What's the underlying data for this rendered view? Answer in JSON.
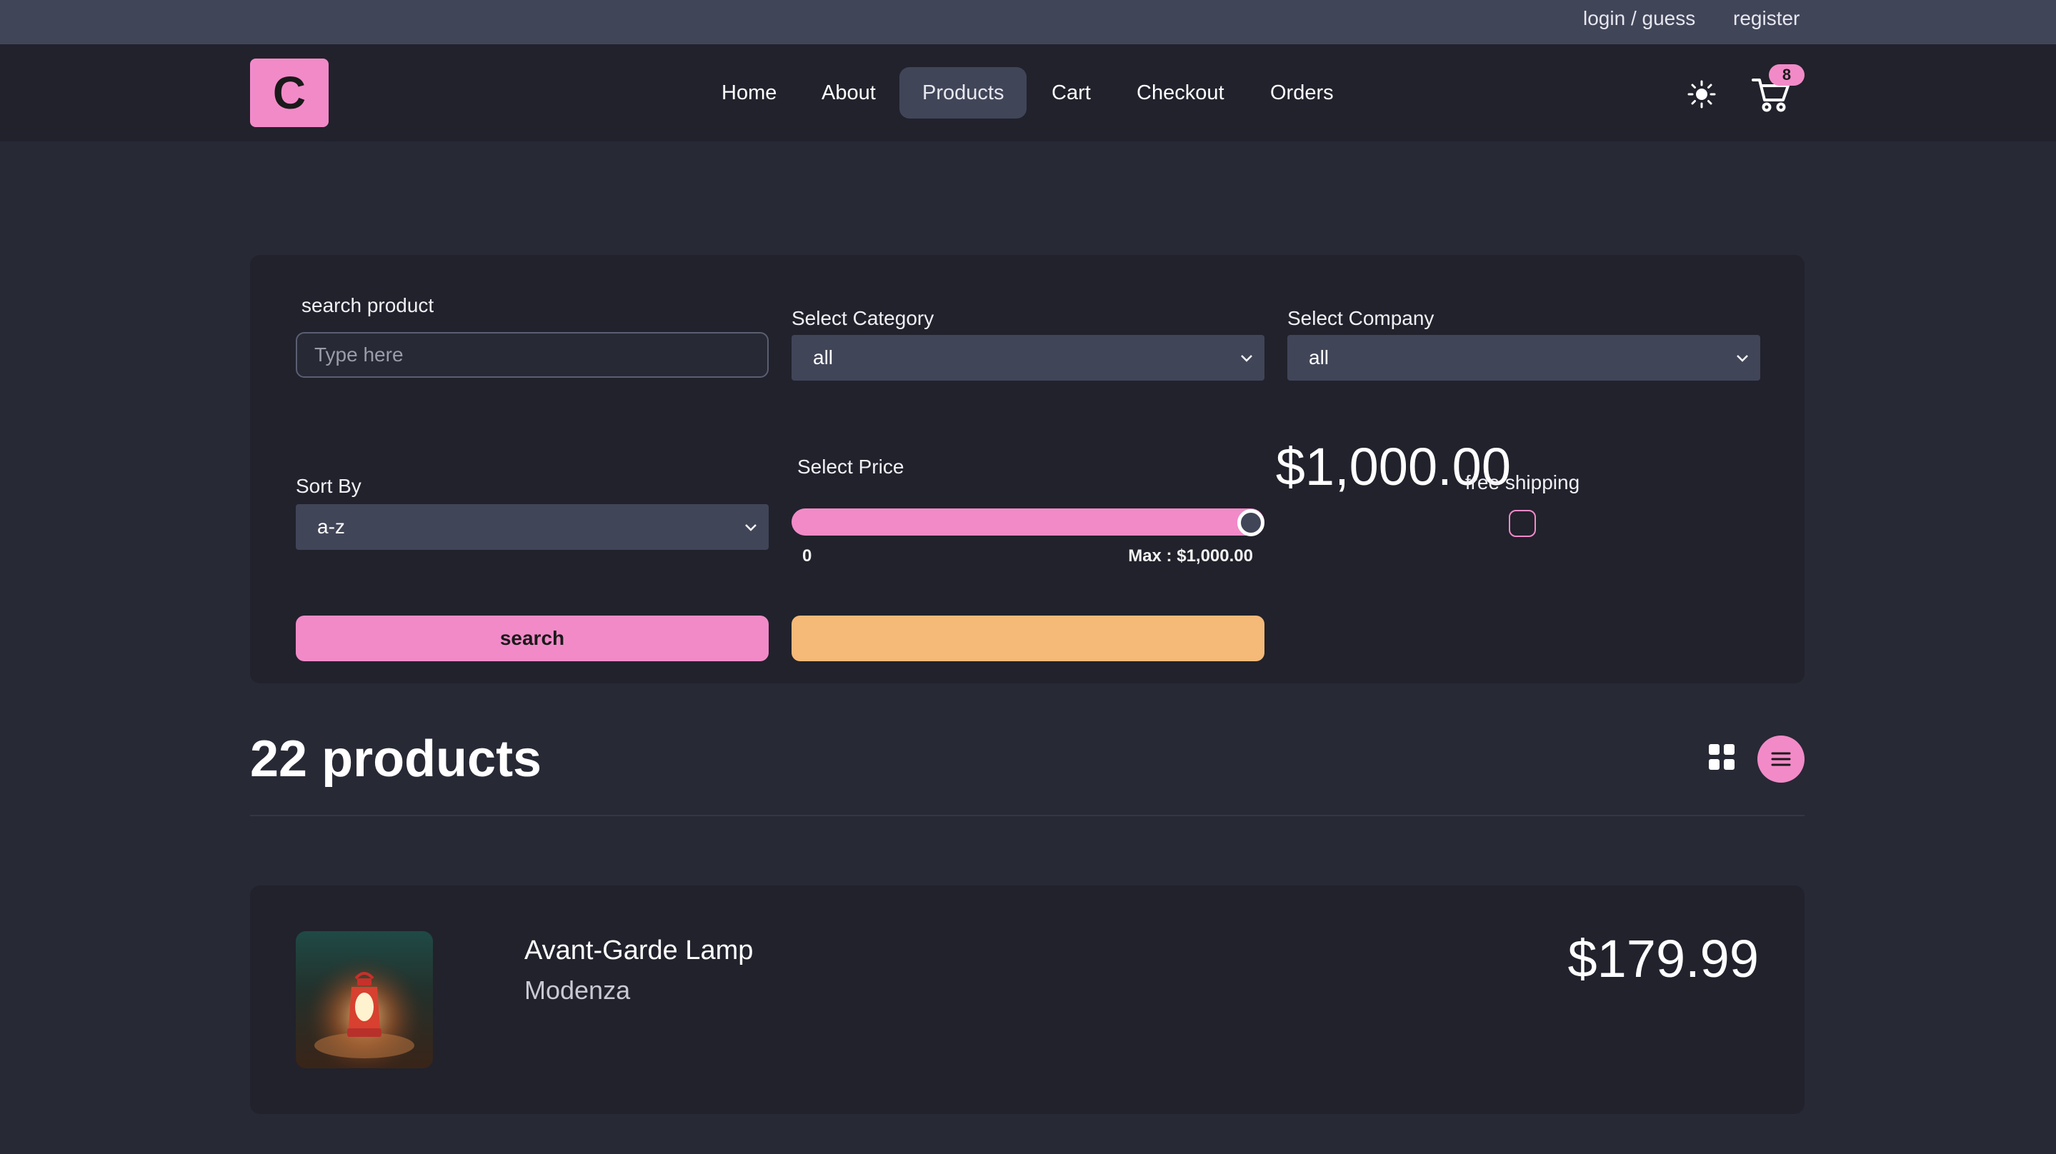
{
  "topbar": {
    "login": "login / guess",
    "register": "register"
  },
  "navbar": {
    "logo": "C",
    "links": [
      "Home",
      "About",
      "Products",
      "Cart",
      "Checkout",
      "Orders"
    ],
    "active": "Products",
    "cart_count": "8"
  },
  "filters": {
    "search_label": "search product",
    "search_placeholder": "Type here",
    "search_value": "",
    "category_label": "Select Category",
    "category_value": "all",
    "company_label": "Select Company",
    "company_value": "all",
    "sort_label": "Sort By",
    "sort_value": "a-z",
    "price_label": "Select Price",
    "price_value": "$1,000.00",
    "price_min": "0",
    "price_max": "Max : $1,000.00",
    "price_fraction": 1.0,
    "shipping_label": "free shipping",
    "shipping_checked": false,
    "search_button": "search",
    "reset_button": ""
  },
  "results": {
    "count": "22 products",
    "layout": "list"
  },
  "products": [
    {
      "name": "Avant-Garde Lamp",
      "company": "Modenza",
      "price": "$179.99"
    }
  ],
  "colors": {
    "accent": "#f28ac8",
    "secondary": "#f5b978",
    "background": "#272935",
    "panel": "#21222c",
    "topbar": "#414558"
  }
}
